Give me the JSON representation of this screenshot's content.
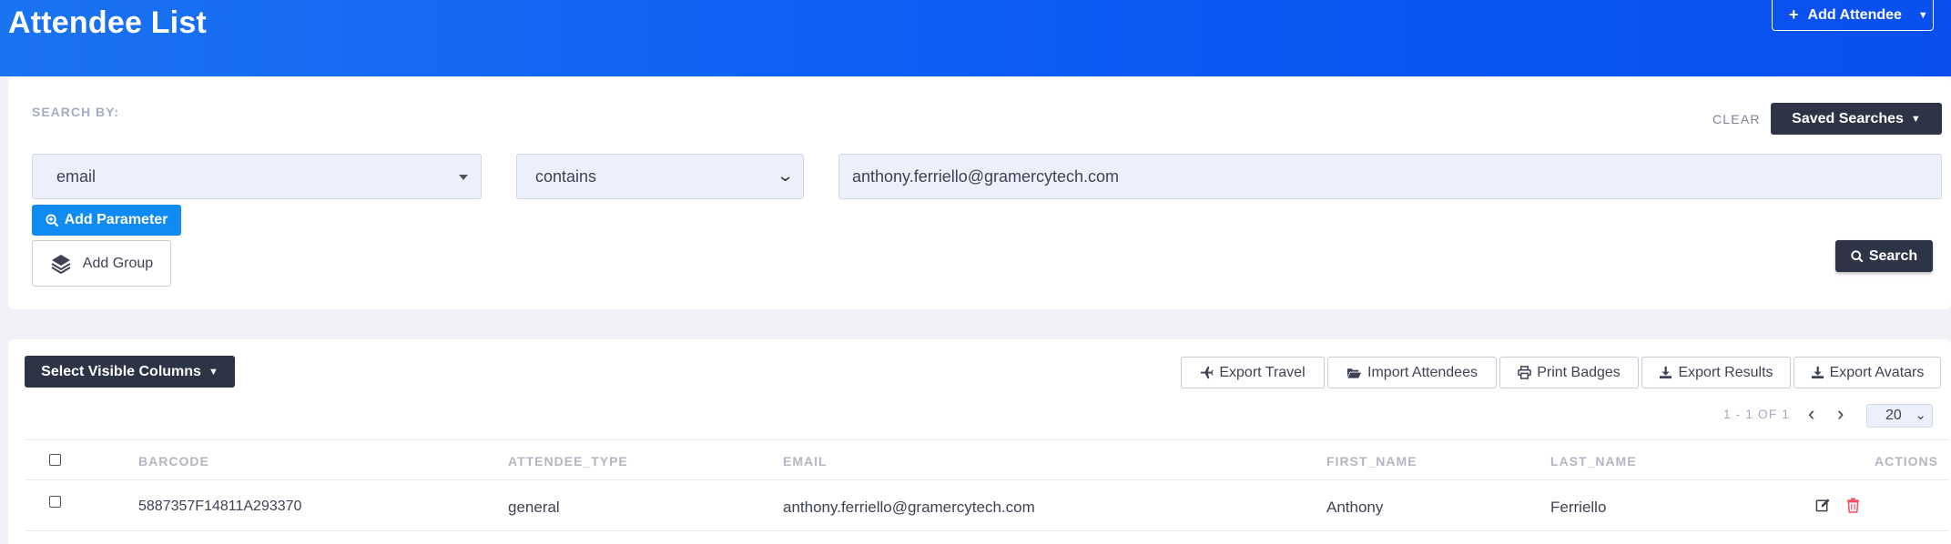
{
  "header": {
    "title": "Attendee List",
    "add_attendee_label": "Add Attendee"
  },
  "search": {
    "search_by_label": "SEARCH BY:",
    "clear_label": "CLEAR",
    "saved_searches_label": "Saved Searches",
    "field_value": "email",
    "operator_value": "contains",
    "query_value": "anthony.ferriello@gramercytech.com",
    "add_parameter_label": "Add Parameter",
    "add_group_label": "Add Group",
    "search_label": "Search"
  },
  "results": {
    "select_columns_label": "Select Visible Columns",
    "toolbar": {
      "export_travel": "Export Travel",
      "import_attendees": "Import Attendees",
      "print_badges": "Print Badges",
      "export_results": "Export Results",
      "export_avatars": "Export Avatars"
    },
    "pager": {
      "text": "1 - 1 OF 1",
      "page_size": "20"
    },
    "columns": [
      "BARCODE",
      "ATTENDEE_TYPE",
      "EMAIL",
      "FIRST_NAME",
      "LAST_NAME",
      "ACTIONS"
    ],
    "rows": [
      {
        "barcode": "5887357F14811A293370",
        "attendee_type": "general",
        "email": "anthony.ferriello@gramercytech.com",
        "first_name": "Anthony",
        "last_name": "Ferriello"
      }
    ]
  },
  "colors": {
    "header_blue": "#0b5bf5",
    "dark_button": "#2d3445",
    "primary_button": "#0f8bf3",
    "delete_red": "#f64e60"
  },
  "icons": [
    "plus-icon",
    "caret-down-icon",
    "search-plus-icon",
    "layers-icon",
    "search-icon",
    "plane-icon",
    "folder-open-icon",
    "print-icon",
    "download-icon",
    "chevron-left-icon",
    "chevron-right-icon",
    "edit-icon",
    "trash-icon"
  ]
}
